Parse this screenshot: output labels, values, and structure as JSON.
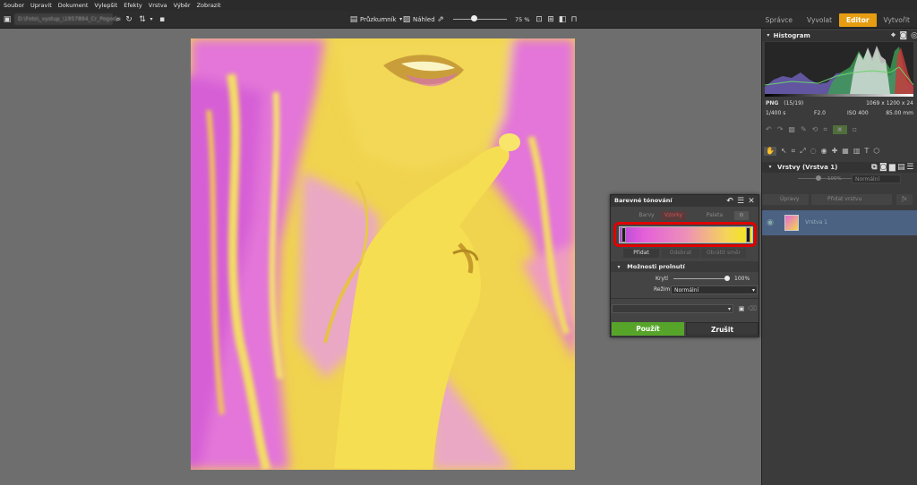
{
  "menu": [
    "Soubor",
    "Upravit",
    "Dokument",
    "Vylepšit",
    "Efekty",
    "Vrstva",
    "Výběr",
    "Zobrazit"
  ],
  "toolbar": {
    "path": "D:\\Foto\\_vystup_\\1957894_Cr_Pogodin",
    "browser_label": "Průzkumník",
    "preview_label": "Náhled",
    "zoom": "75 %"
  },
  "modes": [
    "Správce",
    "Vyvolat",
    "Editor",
    "Vytvořit"
  ],
  "active_mode": "Editor",
  "histogram": {
    "title": "Histogram",
    "format": "PNG",
    "index": "(15/19)",
    "dimensions": "1069 x 1200 x 24",
    "shutter": "1/400 s",
    "aperture": "F2.0",
    "iso": "ISO 400",
    "focal": "85.00 mm"
  },
  "layers": {
    "title": "Vrstvy (Vrstva 1)",
    "opacity": "100%",
    "blend": "Normální",
    "adjust_button": "Úpravy",
    "add_layer_button": "Přidat vrstvu",
    "items": [
      {
        "name": "Vrstva 1"
      }
    ]
  },
  "dialog": {
    "title": "Barevné tónování",
    "tab_left": "Barvy",
    "tab_mid": "Vzorky",
    "tab_right": "Paleta",
    "add_button": "Přidat",
    "remove_button": "Odebrat",
    "reverse_button": "Obrátit směr",
    "blend_section": "Možnosti prolnutí",
    "opacity_label": "Krytí",
    "opacity_value": "100%",
    "mode_label": "Režim",
    "mode_value": "Normální",
    "apply": "Použít",
    "cancel": "Zrušit",
    "gradient_colors": [
      "#b548d8",
      "#e45fd9",
      "#ed90b8",
      "#f5d35a",
      "#f2ea13"
    ]
  },
  "colors": {
    "accent": "#e79d12",
    "apply": "#56a52a",
    "highlight": "#e00000",
    "layer_selected": "#4b6283"
  }
}
